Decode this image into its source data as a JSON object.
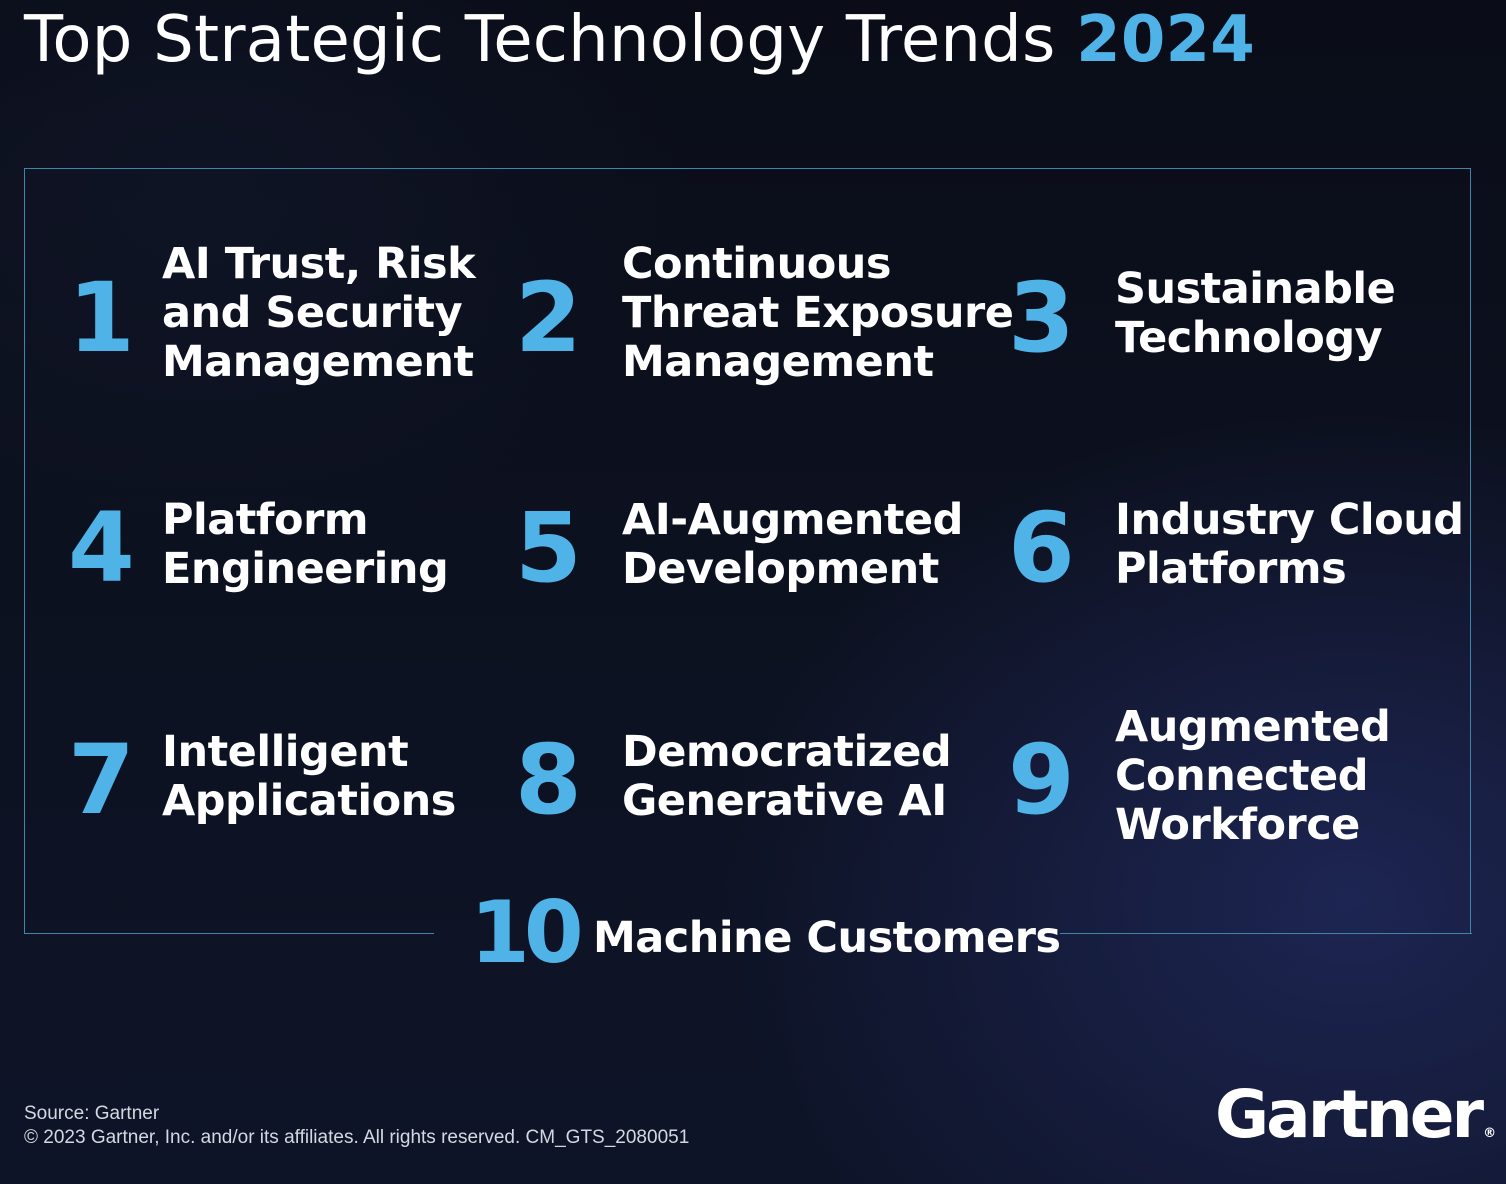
{
  "header": {
    "title_prefix": "Top Strategic Technology Trends",
    "title_year": "2024"
  },
  "trends": [
    {
      "number": "1",
      "lines": [
        "AI Trust, Risk",
        "and Security",
        "Management"
      ]
    },
    {
      "number": "2",
      "lines": [
        "Continuous",
        "Threat Exposure",
        "Management"
      ]
    },
    {
      "number": "3",
      "lines": [
        "Sustainable",
        "Technology"
      ]
    },
    {
      "number": "4",
      "lines": [
        "Platform",
        "Engineering"
      ]
    },
    {
      "number": "5",
      "lines": [
        "AI-Augmented",
        "Development"
      ]
    },
    {
      "number": "6",
      "lines": [
        "Industry Cloud",
        "Platforms"
      ]
    },
    {
      "number": "7",
      "lines": [
        "Intelligent",
        "Applications"
      ]
    },
    {
      "number": "8",
      "lines": [
        "Democratized",
        "Generative AI"
      ]
    },
    {
      "number": "9",
      "lines": [
        "Augmented",
        "Connected",
        "Workforce"
      ]
    },
    {
      "number": "10",
      "lines": [
        "Machine Customers"
      ]
    }
  ],
  "footer": {
    "source": "Source: Gartner",
    "copyright": "© 2023 Gartner, Inc. and/or its affiliates. All rights reserved. CM_GTS_2080051",
    "logo_text": "Gartner",
    "logo_mark": "®"
  },
  "colors": {
    "accent": "#4fb3e8",
    "background": "#0b0f1c",
    "frame": "#3c86a9",
    "text": "#ffffff"
  }
}
